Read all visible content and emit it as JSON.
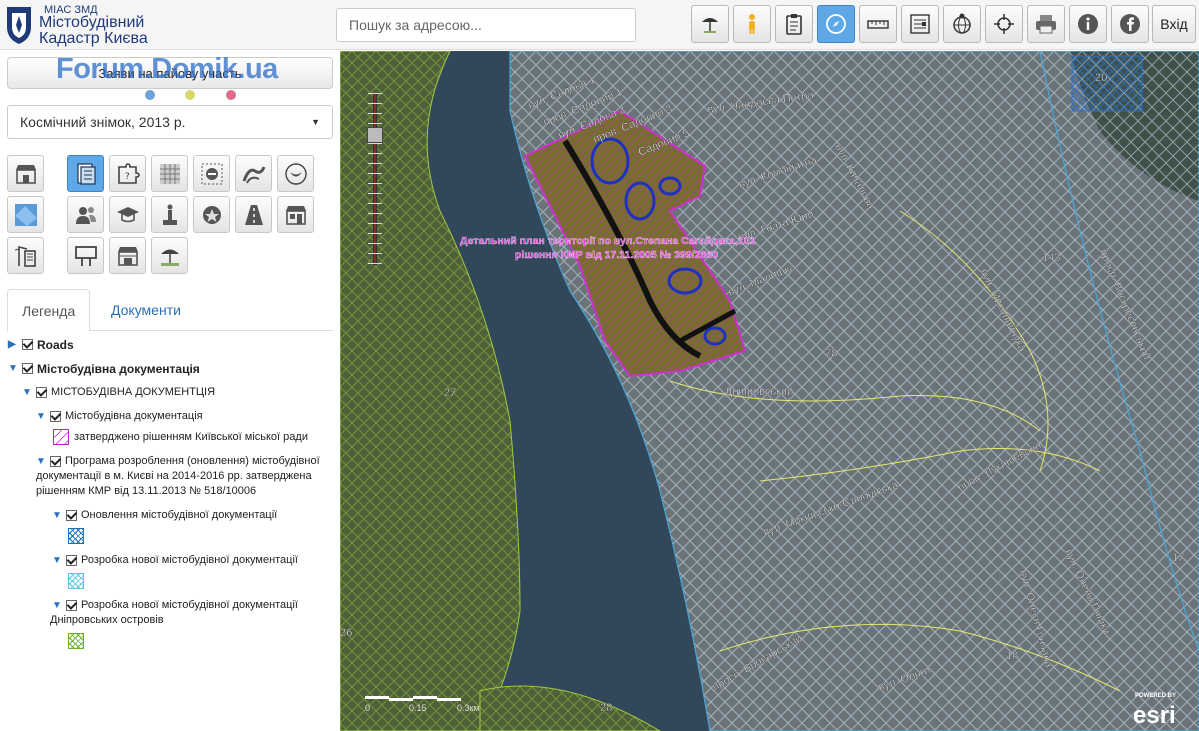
{
  "header": {
    "logo_small": "МІАС ЗМД",
    "logo_line1": "Містобудівний",
    "logo_line2": "Кадастр Києва",
    "search_placeholder": "Пошук за адресою...",
    "toolbar_icons": [
      "beach-umbrella-icon",
      "person-icon",
      "clipboard-icon",
      "compass-icon",
      "measure-ruler-icon",
      "map-legend-icon",
      "globe-pin-icon",
      "crosshair-icon",
      "printer-icon",
      "info-icon",
      "facebook-icon"
    ],
    "exit_label": "Вхід"
  },
  "sidebar": {
    "apply_button": "Заяви на пайову участь",
    "watermark": "Forum.Domik.ua",
    "dot_colors": [
      "#6fa0d8",
      "#d8d86a",
      "#e06a8a"
    ],
    "basemap_select": "Космічний знімок, 2013 р.",
    "layer_icons": [
      "store-icon",
      "document-layers-icon",
      "puzzle-icon",
      "grid-pattern-icon",
      "no-entry-icon",
      "road-interchange-icon",
      "leaf-icon",
      "map-area-icon",
      "people-icon",
      "graduation-cap-icon",
      "monument-icon",
      "police-badge-icon",
      "road-icon",
      "shop-icon",
      "building-crane-icon",
      "billboard-icon",
      "kiosk-icon",
      "beach-icon"
    ],
    "tabs": [
      "Легенда",
      "Документи"
    ]
  },
  "legend": {
    "roads": "Roads",
    "urban_docs": "Містобудівна документація",
    "urban_docs_caps": "МІСТОБУДІВНА ДОКУМЕНТЦІЯ",
    "urban_docs_sub": "Містобудівна документація",
    "approved": "затверджено рішенням Київської міської ради",
    "program_l1": "Програма розроблення (оновлення) містобудівної",
    "program_l2": "документації в м. Києві на 2014-2016 рр. затверджена",
    "program_l3": "рішенням КМР від 13.11.2013 № 518/10006",
    "update": "Оновлення містобудівної документації",
    "new_dev": "Розробка нової містобудівної документації",
    "new_dev_islands_l1": "Розробка нової містобудівної документації",
    "new_dev_islands_l2": "Дніпровських островів",
    "colors": {
      "approved": "#c020c0",
      "update": "#1f6fb0",
      "new_dev": "#5ac8e8",
      "islands": "#6ab030"
    }
  },
  "map": {
    "streets": [
      "вул. Садова 1",
      "пров. Садовий 1",
      "вул. Садова 2",
      "пров. Садовий 3",
      "Садовий 5",
      "вул. Чаадаєва Петра",
      "вул. Комбінатна",
      "вул. Качалова",
      "вул. Гната Юри",
      "вул. Малишка",
      "вул. Миколайчука",
      "вул. Микільсько-Слобідська",
      "пров. Лукашевича",
      "просп. Броварський",
      "вул. Лукашевича",
      "просп. Воскресенський",
      "вул. Олеся Гончара",
      "вул. Старомиру",
      "вул. Ольги",
      "просп. Соборності",
      "вул. Олени Пчілки"
    ],
    "plan_label_l1": "Детальний план території по вул.Степана Сагайдака,101",
    "plan_label_l2": "рішення КМР від 17.11.2005 № 399/2860",
    "district": "Дніпровський",
    "numbers": [
      "20",
      "143",
      "78",
      "27",
      "26",
      "28",
      "17",
      "18"
    ],
    "scale": [
      "0",
      "0.15",
      "0.3км"
    ],
    "attribution": "POWERED BY",
    "esri": "esri"
  }
}
